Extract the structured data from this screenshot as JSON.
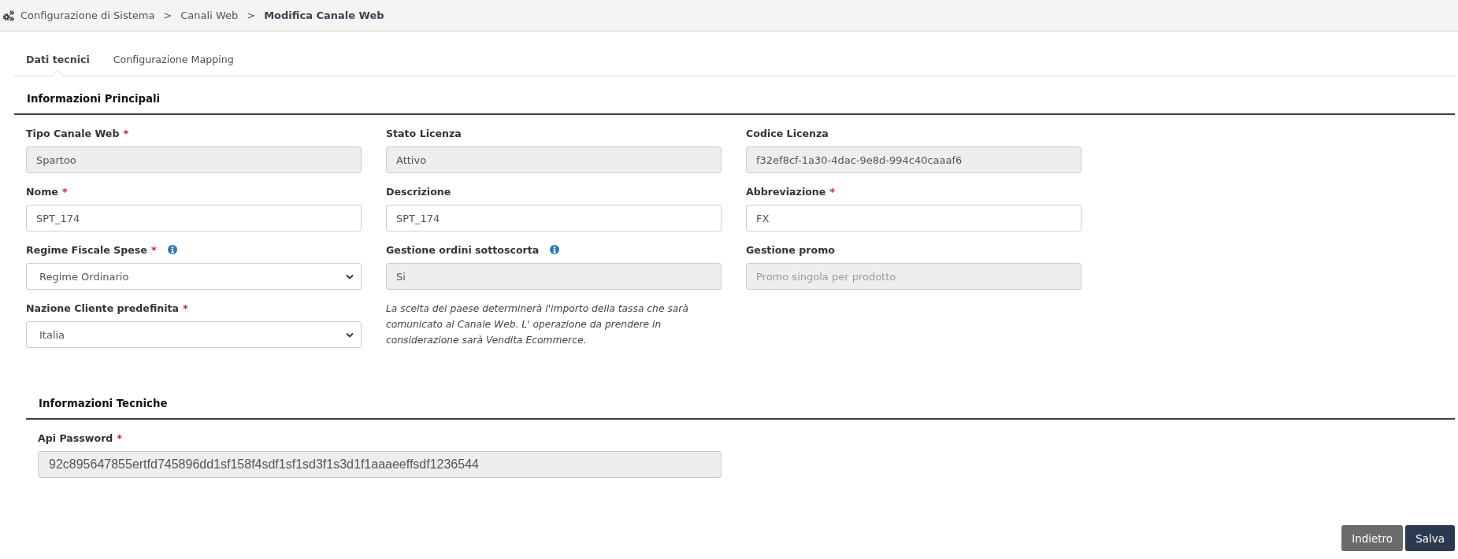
{
  "breadcrumb": [
    {
      "label": "Configurazione di Sistema",
      "current": false
    },
    {
      "separator": ">",
      "label": "Canali Web",
      "current": false
    },
    {
      "separator": ">",
      "label": "Modifica Canale Web",
      "current": true
    }
  ],
  "tabs": [
    {
      "label": "Dati tecnici",
      "selected": true
    },
    {
      "label": "Configurazione Mapping",
      "selected": false
    }
  ],
  "sections": [
    {
      "kind": "main",
      "title": "Informazioni Principali",
      "fields": [
        {
          "kind": "input",
          "label": "Tipo Canale Web",
          "required_mark": "*",
          "info": false,
          "value": "Spartoo",
          "disabled": true
        },
        {
          "kind": "input",
          "label": "Stato Licenza",
          "info": false,
          "value": "Attivo",
          "disabled": true
        },
        {
          "kind": "input",
          "label": "Codice Licenza",
          "info": false,
          "value": "f32ef8cf-1a30-4dac-9e8d-994c40caaaf6",
          "disabled": true
        },
        {
          "kind": "input",
          "label": "Nome",
          "required_mark": "*",
          "info": false,
          "value": "SPT_174",
          "disabled": false
        },
        {
          "kind": "input",
          "label": "Descrizione",
          "info": false,
          "value": "SPT_174",
          "disabled": false
        },
        {
          "kind": "input",
          "label": "Abbreviazione",
          "required_mark": "*",
          "info": false,
          "value": "FX",
          "disabled": false
        },
        {
          "kind": "select",
          "label": "Regime Fiscale Spese",
          "required_mark": "*",
          "info": true,
          "value": "Regime Ordinario",
          "disabled": false
        },
        {
          "kind": "input",
          "label": "Gestione ordini sottoscorta",
          "info": true,
          "value": "Si",
          "disabled": true
        },
        {
          "kind": "input",
          "label": "Gestione promo",
          "info": false,
          "placeholder": "Promo singola per prodotto",
          "disabled": true
        },
        {
          "kind": "select",
          "label": "Nazione Cliente predefinita",
          "required_mark": "*",
          "info": false,
          "value": "Italia",
          "disabled": false
        },
        {
          "kind": "note",
          "text": "La scelta del paese determinerà l'importo della tassa che sarà comunicato al Canale Web. L' operazione da prendere in considerazione sarà Vendita Ecommerce."
        }
      ]
    },
    {
      "kind": "technical",
      "title": "Informazioni Tecniche",
      "fields": [
        {
          "kind": "secret",
          "label": "Api Password",
          "required_mark": "*",
          "info": false,
          "value": "92c895647855ertfd745896dd1sf158f4sdf1sf1sd3f1s3d1f1aaaeeffsdf1236544",
          "disabled": true
        }
      ]
    }
  ],
  "buttons": [
    {
      "label": "Indietro",
      "kind": "secondary"
    },
    {
      "label": "Salva",
      "kind": "primary"
    }
  ]
}
